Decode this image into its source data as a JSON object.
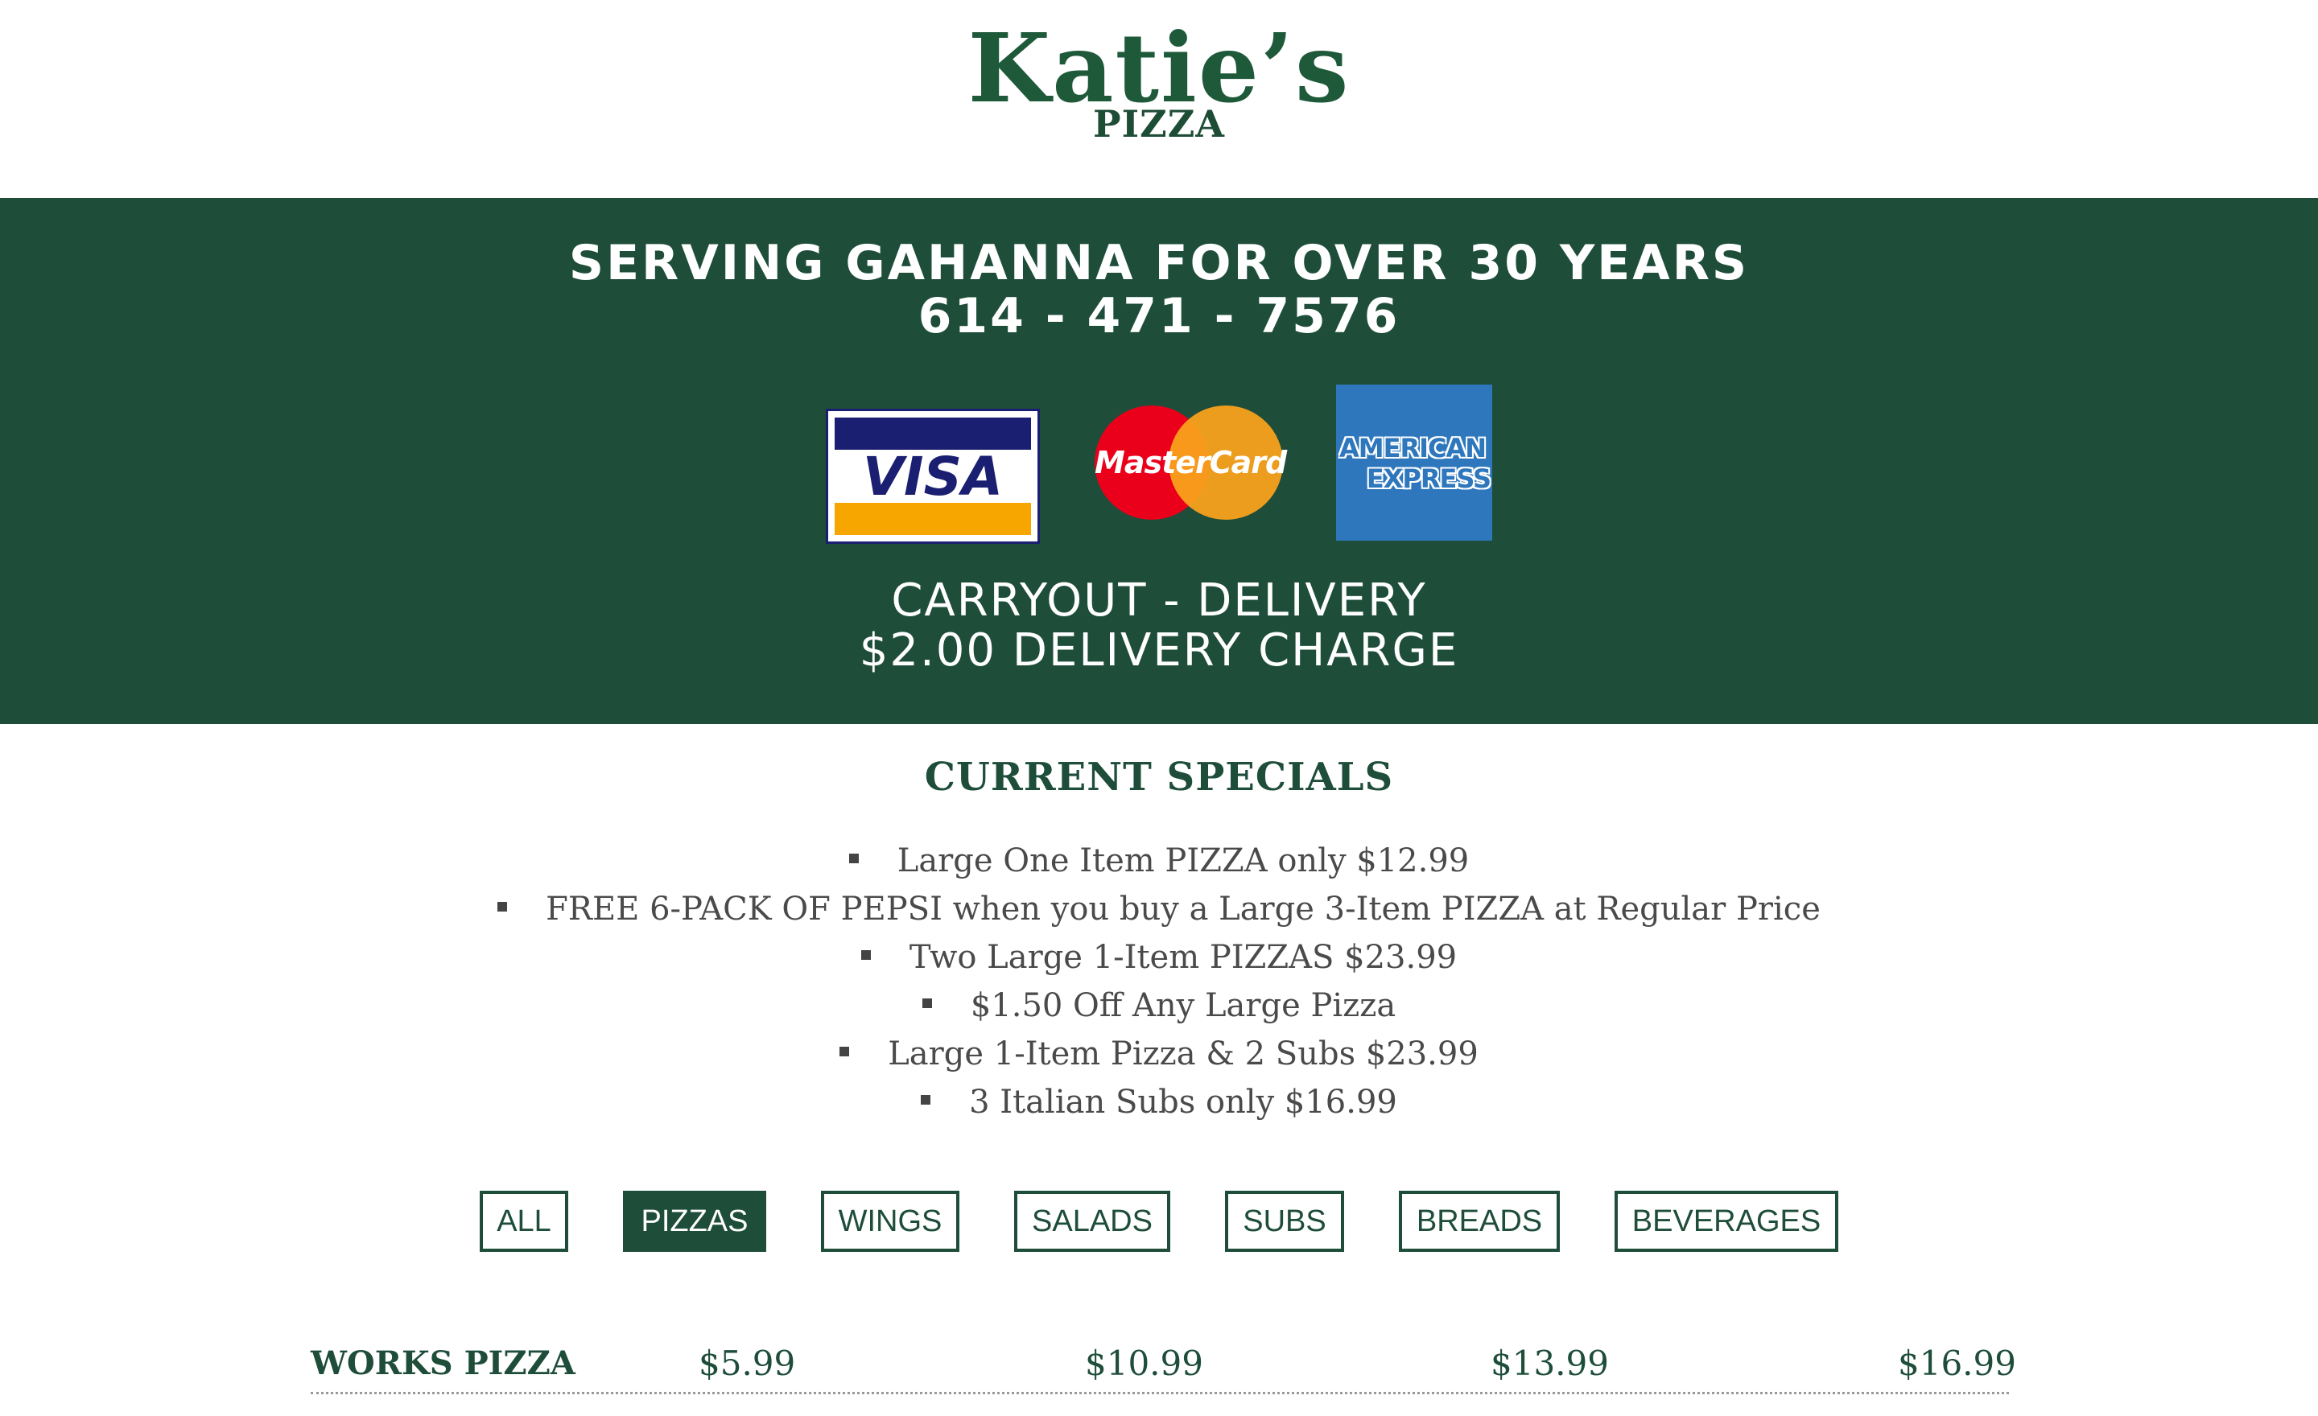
{
  "logo": {
    "title": "Katie’s",
    "subtitle": "PIZZA"
  },
  "banner": {
    "tagline": "SERVING GAHANNA FOR OVER 30 YEARS",
    "phone": "614 - 471 - 7576",
    "service": "CARRYOUT - DELIVERY",
    "delivery_charge": "$2.00 DELIVERY CHARGE",
    "cards": {
      "visa": "VISA",
      "mastercard": "MasterCard",
      "amex_line1": "AMERICAN",
      "amex_line2": "EXPRESS"
    }
  },
  "specials": {
    "heading": "CURRENT SPECIALS",
    "items": [
      "Large One Item PIZZA only $12.99",
      "FREE 6-PACK OF PEPSI when you buy a Large 3-Item PIZZA at Regular Price",
      "Two Large 1-Item PIZZAS $23.99",
      "$1.50 Off Any Large Pizza",
      "Large 1-Item Pizza & 2 Subs $23.99",
      "3 Italian Subs only $16.99"
    ]
  },
  "filters": {
    "active": "PIZZAS",
    "buttons": [
      "ALL",
      "PIZZAS",
      "WINGS",
      "SALADS",
      "SUBS",
      "BREADS",
      "BEVERAGES"
    ]
  },
  "menu": {
    "rows": [
      {
        "name": "WORKS PIZZA",
        "prices": [
          "$5.99",
          "$10.99",
          "$13.99",
          "$16.99"
        ]
      }
    ]
  },
  "colors": {
    "brand_green": "#1e4d3a",
    "visa_blue": "#1a1f71",
    "visa_gold": "#f7a600",
    "mc_red": "#eb001b",
    "mc_yellow": "#f9a11b",
    "amex_blue": "#2e77bc"
  }
}
